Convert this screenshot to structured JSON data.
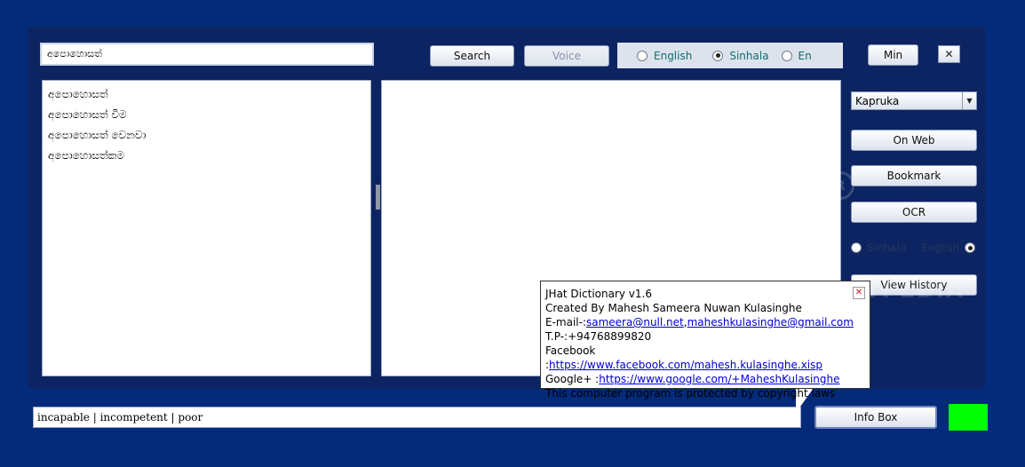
{
  "search": {
    "value": "අපොහොසත්",
    "search_label": "Search",
    "voice_label": "Voice"
  },
  "language": {
    "options": [
      {
        "label": "English",
        "selected": false
      },
      {
        "label": "Sinhala",
        "selected": true
      },
      {
        "label": "En",
        "selected": false
      }
    ]
  },
  "window": {
    "min_label": "Min",
    "close_label": "✕"
  },
  "word_list": {
    "items": [
      "අපොහොසත්",
      "අපොහොසත් වීම",
      "අපොහොසත් වෙනවා",
      "අපොහොසත්කම"
    ]
  },
  "sidebar": {
    "source_select": "Kapruka",
    "on_web_label": "On Web",
    "bookmark_label": "Bookmark",
    "ocr_label": "OCR",
    "ocr_lang_sinhala": "Sinhala",
    "ocr_lang_english": "English",
    "view_history_label": "View History"
  },
  "bottom": {
    "translation": "incapable | incompetent | poor",
    "info_box_label": "Info Box",
    "status_color": "#00ff00"
  },
  "tooltip": {
    "line1": "JHat Dictionary v1.6",
    "line2": "Created By Mahesh Sameera Nuwan Kulasinghe",
    "email_prefix": "E-mail-:",
    "email1": "sameera@null.net",
    "email_sep": ",",
    "email2": "maheshkulasinghe@gmail.com",
    "phone": "T.P-:+94768899820",
    "facebook_prefix": "Facebook :",
    "facebook_url": "https://www.facebook.com/mahesh.kulasinghe.xisp",
    "google_prefix": "Google+ :",
    "google_url": "https://www.google.com/+MaheshKulasinghe",
    "copyright": "This computer program is protected by copyright laws"
  },
  "watermark": "SOFTPEDIA"
}
